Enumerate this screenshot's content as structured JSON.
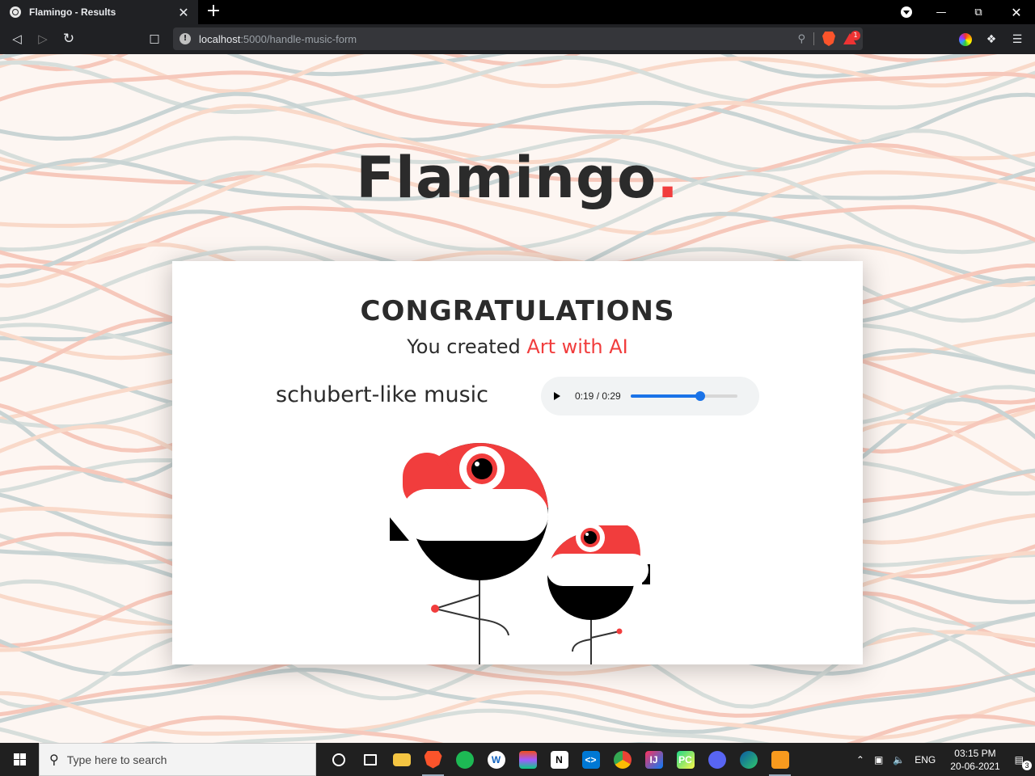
{
  "browser": {
    "tab_title": "Flamingo - Results",
    "tab_close": "✕",
    "new_tab": "+",
    "url_host": "localhost",
    "url_path": ":5000/handle-music-form",
    "badge_count": "1"
  },
  "page": {
    "brand_name": "Flamingo",
    "brand_dot": ".",
    "heading": "CONGRATULATIONS",
    "subline_prefix": "You created ",
    "subline_accent": "Art with AI",
    "music_label": "schubert-like music",
    "player": {
      "time": "0:19 / 0:29",
      "progress_fraction": 0.655
    },
    "colors": {
      "accent": "#f13d3d",
      "text": "#2b2b2b"
    }
  },
  "taskbar": {
    "search_placeholder": "Type here to search",
    "language": "ENG",
    "time": "03:15 PM",
    "date": "20-06-2021",
    "notification_count": "3"
  }
}
